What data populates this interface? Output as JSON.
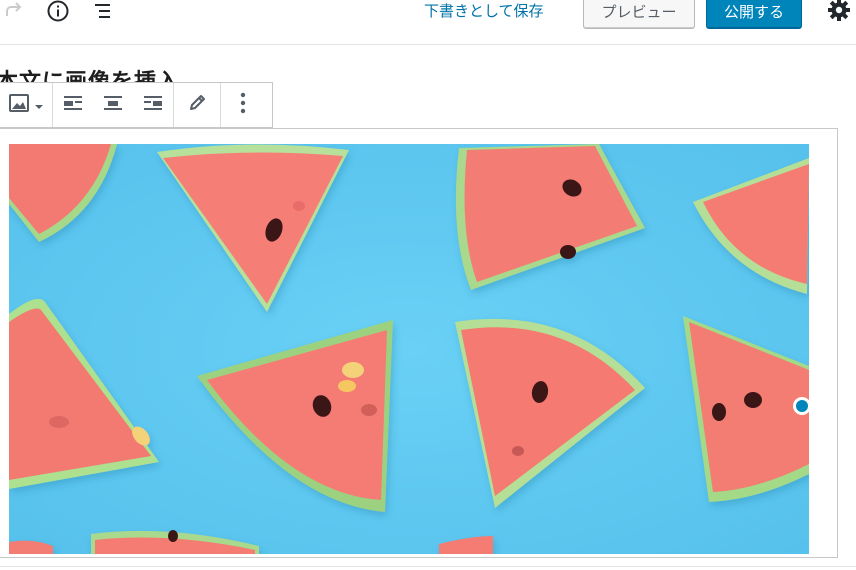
{
  "topbar": {
    "redo_icon": "redo-icon",
    "info_icon": "info-icon",
    "outline_icon": "block-navigation-icon",
    "save_draft_label": "下書きとして保存",
    "preview_label": "プレビュー",
    "publish_label": "公開する",
    "settings_icon": "gear-icon"
  },
  "post": {
    "title": "本文に画像を挿入"
  },
  "block_toolbar": {
    "buttons": [
      "image-icon",
      "chevron-down-icon",
      "align-left-icon",
      "align-center-icon",
      "align-right-icon",
      "pencil-icon",
      "more-vertical-icon"
    ]
  },
  "image_block": {
    "subject": "watermelon slices on blue background",
    "background_color": "#5ec7ee"
  },
  "colors": {
    "accent": "#0085ba",
    "link": "#0073aa"
  }
}
